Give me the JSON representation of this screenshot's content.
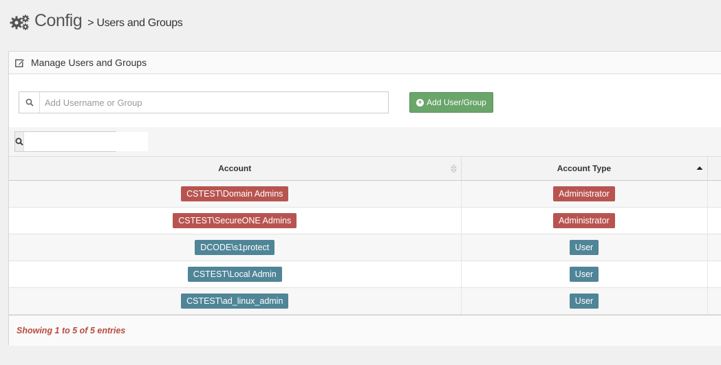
{
  "header": {
    "title": "Config",
    "breadcrumb": "> Users and Groups",
    "icon": "gears-icon"
  },
  "panel": {
    "heading": "Manage Users and Groups",
    "heading_icon": "edit-icon",
    "add_input": {
      "value": "",
      "placeholder": "Add Username or Group"
    },
    "add_button": {
      "label": "Add User/Group",
      "icon": "plus-circle-icon",
      "color": "#6aa56a"
    },
    "filter": {
      "value": "",
      "placeholder": ""
    }
  },
  "table": {
    "columns": [
      {
        "label": "Account",
        "sort": "none"
      },
      {
        "label": "Account Type",
        "sort": "ascending"
      }
    ],
    "rows": [
      {
        "account": "CSTEST\\Domain Admins",
        "type": "Administrator",
        "color": "#b85450"
      },
      {
        "account": "CSTEST\\SecureONE Admins",
        "type": "Administrator",
        "color": "#b85450"
      },
      {
        "account": "DCODE\\s1protect",
        "type": "User",
        "color": "#4f8597"
      },
      {
        "account": "CSTEST\\Local Admin",
        "type": "User",
        "color": "#4f8597"
      },
      {
        "account": "CSTEST\\ad_linux_admin",
        "type": "User",
        "color": "#4f8597"
      }
    ],
    "footer": "Showing 1 to 5 of 5 entries",
    "footer_color": "#b84a3e"
  }
}
